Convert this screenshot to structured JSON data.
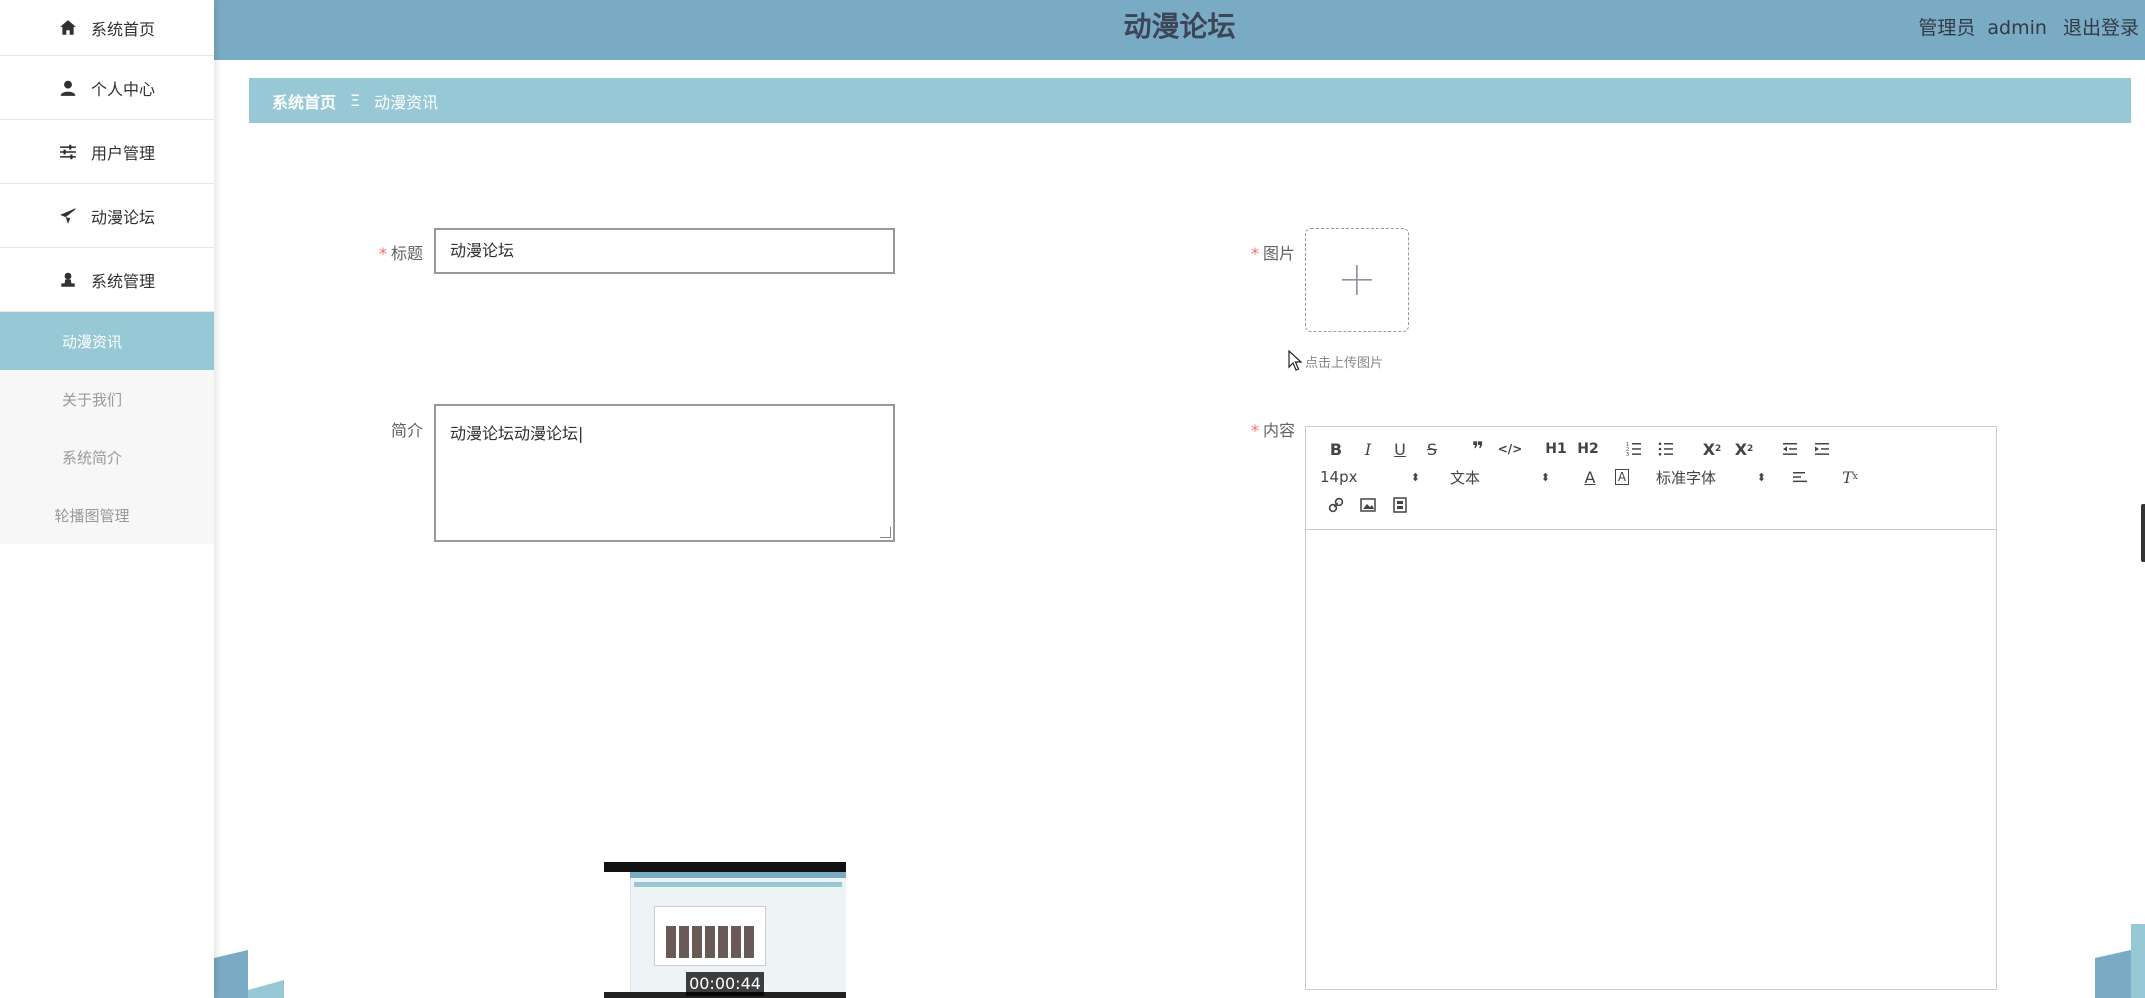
{
  "header": {
    "title": "动漫论坛",
    "role": "管理员",
    "username": "admin",
    "logout": "退出登录"
  },
  "sidebar": {
    "items": [
      {
        "label": "系统首页",
        "icon": "home-icon"
      },
      {
        "label": "个人中心",
        "icon": "user-icon"
      },
      {
        "label": "用户管理",
        "icon": "sliders-icon"
      },
      {
        "label": "动漫论坛",
        "icon": "send-icon"
      },
      {
        "label": "系统管理",
        "icon": "user-stamp-icon"
      }
    ],
    "submenu": [
      {
        "label": "动漫资讯",
        "active": true
      },
      {
        "label": "关于我们",
        "active": false
      },
      {
        "label": "系统简介",
        "active": false
      },
      {
        "label": "轮播图管理",
        "active": false
      }
    ]
  },
  "breadcrumb": {
    "home": "系统首页",
    "separator": "Ξ",
    "current": "动漫资讯"
  },
  "form": {
    "title_label": "标题",
    "title_value": "动漫论坛",
    "intro_label": "简介",
    "intro_value": "动漫论坛动漫论坛|",
    "image_label": "图片",
    "upload_tip": "点击上传图片",
    "content_label": "内容",
    "required_mark": "*"
  },
  "editor": {
    "font_size": "14px",
    "paragraph": "文本",
    "font_family": "标准字体",
    "h1": "H1",
    "h2": "H2"
  },
  "video": {
    "timestamp": "00:00:44"
  },
  "colors": {
    "header": "#79abc4",
    "accent": "#97c8d5",
    "required": "#f56c6c"
  }
}
